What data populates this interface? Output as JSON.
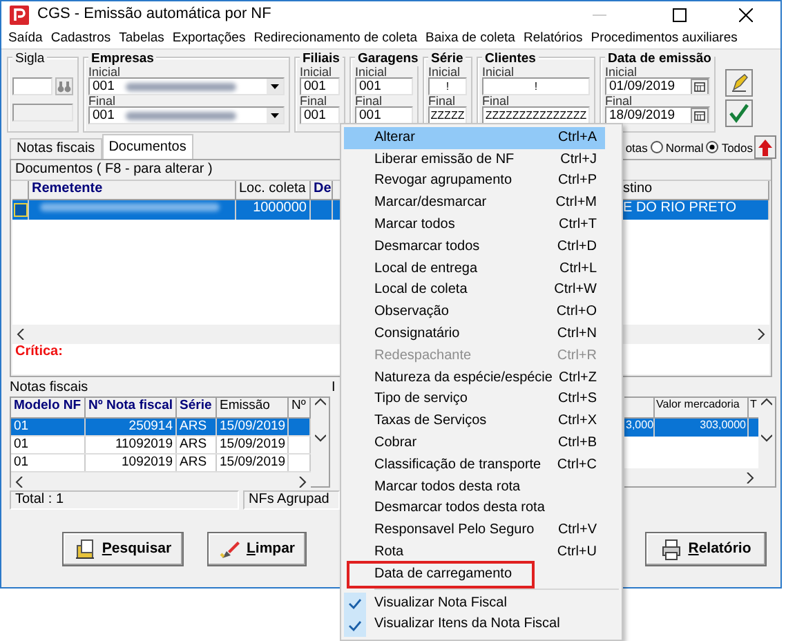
{
  "window": {
    "title": "CGS - Emissão automática por NF"
  },
  "menu_bar": [
    "Saída",
    "Cadastros",
    "Tabelas",
    "Exportações",
    "Redirecionamento de coleta",
    "Baixa de coleta",
    "Relatórios",
    "Procedimentos auxiliares"
  ],
  "filters": [
    {
      "kind": "sigla",
      "label": "Sigla"
    },
    {
      "kind": "combo",
      "label": "Empresas",
      "initial_label": "Inicial",
      "initial": "001",
      "final_label": "Final",
      "final": "001"
    },
    {
      "kind": "text",
      "label": "Filiais",
      "initial_label": "Inicial",
      "initial": "001",
      "final_label": "Final",
      "final": "001"
    },
    {
      "kind": "text",
      "label": "Garagens",
      "initial_label": "Inicial",
      "initial": "001",
      "final_label": "Final",
      "final": "001"
    },
    {
      "kind": "center",
      "label": "Série",
      "initial_label": "Inicial",
      "initial": "!",
      "final_label": "Final",
      "final": "ZZZZZ"
    },
    {
      "kind": "center",
      "label": "Clientes",
      "initial_label": "Inicial",
      "initial": "!",
      "final_label": "Final",
      "final": "ZZZZZZZZZZZZZZZ"
    },
    {
      "kind": "date",
      "label": "Data de emissão",
      "initial_label": "Inicial",
      "initial": "01/09/2019",
      "final_label": "Final",
      "final": "18/09/2019"
    }
  ],
  "tabs": [
    {
      "label": "Notas fiscais",
      "selected": false
    },
    {
      "label": "Documentos",
      "selected": true
    }
  ],
  "view_filter": {
    "label": "otas",
    "options": [
      {
        "label": "Normal",
        "selected": false
      },
      {
        "label": "Todos",
        "selected": true
      }
    ]
  },
  "documents": {
    "title": "Documentos ( F8 - para alterar )",
    "columns": [
      "Remetente",
      "Loc. coleta",
      "De"
    ],
    "right_column": "stino",
    "rows": [
      {
        "checked": false,
        "selected": true,
        "loc_coleta": "1000000",
        "destino": "E DO RIO PRETO"
      }
    ],
    "critica": "Crítica:"
  },
  "notas": {
    "title": "Notas fiscais",
    "columns": [
      {
        "label": "Modelo NF",
        "key": true
      },
      {
        "label": "Nº Nota fiscal",
        "key": true
      },
      {
        "label": "Série",
        "key": true
      },
      {
        "label": "Emissão",
        "key": false
      },
      {
        "label": "Nº",
        "key": false
      }
    ],
    "rows": [
      {
        "cells": [
          "01",
          "250914",
          "ARS",
          "15/09/2019",
          ""
        ],
        "selected": true
      },
      {
        "cells": [
          "01",
          "11092019",
          "ARS",
          "15/09/2019",
          ""
        ],
        "selected": false
      },
      {
        "cells": [
          "01",
          "1092019",
          "ARS",
          "15/09/2019",
          ""
        ],
        "selected": false
      }
    ]
  },
  "itens": {
    "title": "I",
    "columns": [
      "",
      "Valor mercadoria",
      "T"
    ],
    "rows": [
      {
        "cells": [
          "3,000",
          "303,0000"
        ],
        "selected": true
      }
    ]
  },
  "status_bar": [
    "Total : 1",
    "NFs Agrupad"
  ],
  "buttons": [
    {
      "label": "Pesquisar",
      "kind": "search"
    },
    {
      "label": "Limpar",
      "kind": "clear"
    },
    {
      "label": "Relatório",
      "kind": "report"
    }
  ],
  "context_menu": [
    {
      "kind": "item",
      "label": "Alterar",
      "shortcut": "Ctrl+A",
      "selected": true,
      "disabled": false,
      "checked": false,
      "framed": false
    },
    {
      "kind": "item",
      "label": "Liberar emissão de NF",
      "shortcut": "Ctrl+J",
      "selected": false,
      "disabled": false,
      "checked": false,
      "framed": false
    },
    {
      "kind": "item",
      "label": "Revogar agrupamento",
      "shortcut": "Ctrl+P",
      "selected": false,
      "disabled": false,
      "checked": false,
      "framed": false
    },
    {
      "kind": "item",
      "label": "Marcar/desmarcar",
      "shortcut": "Ctrl+M",
      "selected": false,
      "disabled": false,
      "checked": false,
      "framed": false
    },
    {
      "kind": "item",
      "label": "Marcar todos",
      "shortcut": "Ctrl+T",
      "selected": false,
      "disabled": false,
      "checked": false,
      "framed": false
    },
    {
      "kind": "item",
      "label": "Desmarcar todos",
      "shortcut": "Ctrl+D",
      "selected": false,
      "disabled": false,
      "checked": false,
      "framed": false
    },
    {
      "kind": "item",
      "label": "Local de entrega",
      "shortcut": "Ctrl+L",
      "selected": false,
      "disabled": false,
      "checked": false,
      "framed": false
    },
    {
      "kind": "item",
      "label": "Local de coleta",
      "shortcut": "Ctrl+W",
      "selected": false,
      "disabled": false,
      "checked": false,
      "framed": false
    },
    {
      "kind": "item",
      "label": "Observação",
      "shortcut": "Ctrl+O",
      "selected": false,
      "disabled": false,
      "checked": false,
      "framed": false
    },
    {
      "kind": "item",
      "label": "Consignatário",
      "shortcut": "Ctrl+N",
      "selected": false,
      "disabled": false,
      "checked": false,
      "framed": false
    },
    {
      "kind": "item",
      "label": "Redespachante",
      "shortcut": "Ctrl+R",
      "selected": false,
      "disabled": true,
      "checked": false,
      "framed": false
    },
    {
      "kind": "item",
      "label": "Natureza da espécie/espécie",
      "shortcut": "Ctrl+Z",
      "selected": false,
      "disabled": false,
      "checked": false,
      "framed": false
    },
    {
      "kind": "item",
      "label": "Tipo de serviço",
      "shortcut": "Ctrl+S",
      "selected": false,
      "disabled": false,
      "checked": false,
      "framed": false
    },
    {
      "kind": "item",
      "label": "Taxas de Serviços",
      "shortcut": "Ctrl+X",
      "selected": false,
      "disabled": false,
      "checked": false,
      "framed": false
    },
    {
      "kind": "item",
      "label": "Cobrar",
      "shortcut": "Ctrl+B",
      "selected": false,
      "disabled": false,
      "checked": false,
      "framed": false
    },
    {
      "kind": "item",
      "label": "Classificação de transporte",
      "shortcut": "Ctrl+C",
      "selected": false,
      "disabled": false,
      "checked": false,
      "framed": false
    },
    {
      "kind": "item",
      "label": "Marcar todos desta rota",
      "selected": false,
      "disabled": false,
      "checked": false,
      "framed": false
    },
    {
      "kind": "item",
      "label": "Desmarcar todos desta rota",
      "selected": false,
      "disabled": false,
      "checked": false,
      "framed": false
    },
    {
      "kind": "item",
      "label": "Responsavel Pelo Seguro",
      "shortcut": "Ctrl+V",
      "selected": false,
      "disabled": false,
      "checked": false,
      "framed": false
    },
    {
      "kind": "item",
      "label": "Rota",
      "shortcut": "Ctrl+U",
      "selected": false,
      "disabled": false,
      "checked": false,
      "framed": false
    },
    {
      "kind": "item",
      "label": "Data de carregamento",
      "selected": false,
      "disabled": false,
      "checked": false,
      "framed": true
    },
    {
      "kind": "separator"
    },
    {
      "kind": "item",
      "label": "Visualizar Nota Fiscal",
      "selected": false,
      "disabled": false,
      "checked": true,
      "framed": false
    },
    {
      "kind": "item",
      "label": "Visualizar Itens da Nota Fiscal",
      "selected": false,
      "disabled": false,
      "checked": true,
      "framed": false
    }
  ]
}
